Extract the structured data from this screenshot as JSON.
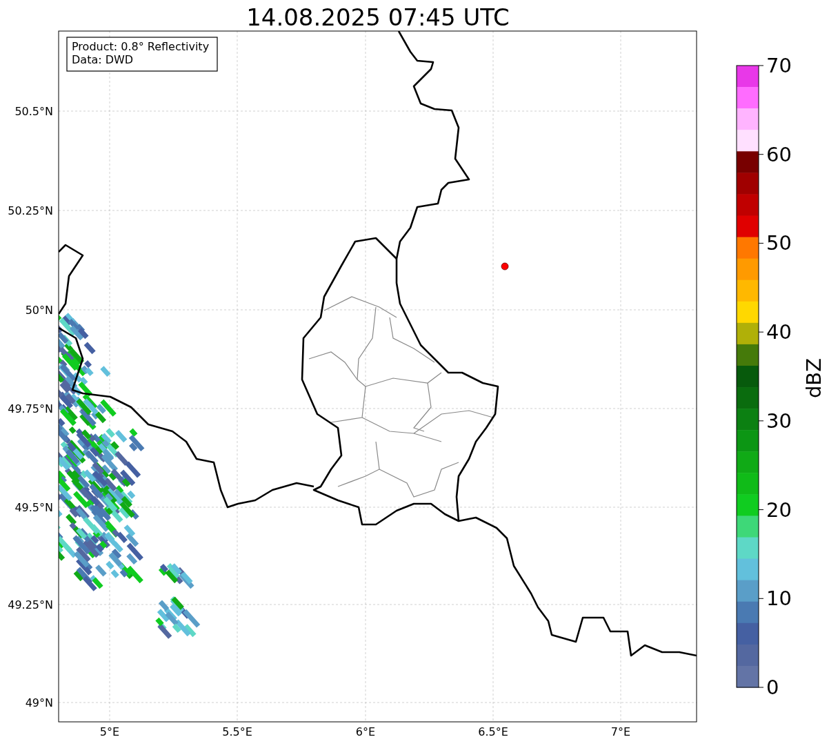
{
  "title": "14.08.2025 07:45 UTC",
  "annotation": [
    "Product: 0.8° Reflectivity",
    "Data: DWD"
  ],
  "y_ticks": [
    "50.5°N",
    "50.25°N",
    "50°N",
    "49.75°N",
    "49.5°N",
    "49.25°N",
    "49°N"
  ],
  "x_ticks": [
    "5°E",
    "5.5°E",
    "6°E",
    "6.5°E",
    "7°E"
  ],
  "colorbar": {
    "label": "dBZ",
    "ticks": [
      "70",
      "60",
      "50",
      "40",
      "30",
      "20",
      "10",
      "0"
    ],
    "bands": [
      {
        "color": "#e838e8"
      },
      {
        "color": "#ff6cff"
      },
      {
        "color": "#ffb4ff"
      },
      {
        "color": "#ffe0ff"
      },
      {
        "color": "#780000"
      },
      {
        "color": "#a00000"
      },
      {
        "color": "#c00000"
      },
      {
        "color": "#e00000"
      },
      {
        "color": "#ff7800"
      },
      {
        "color": "#ff9a00"
      },
      {
        "color": "#ffb800"
      },
      {
        "color": "#ffd800"
      },
      {
        "color": "#b0b008"
      },
      {
        "color": "#457a0a"
      },
      {
        "color": "#075a0c"
      },
      {
        "color": "#0a6c0e"
      },
      {
        "color": "#0c8012"
      },
      {
        "color": "#0c9614"
      },
      {
        "color": "#10aa16"
      },
      {
        "color": "#10bb18"
      },
      {
        "color": "#10cc20"
      },
      {
        "color": "#3ed878"
      },
      {
        "color": "#5ed8c6"
      },
      {
        "color": "#62c0dc"
      },
      {
        "color": "#5a9ec8"
      },
      {
        "color": "#4a7ab2"
      },
      {
        "color": "#4560a2"
      },
      {
        "color": "#5468a0"
      },
      {
        "color": "#6374a6"
      }
    ]
  }
}
